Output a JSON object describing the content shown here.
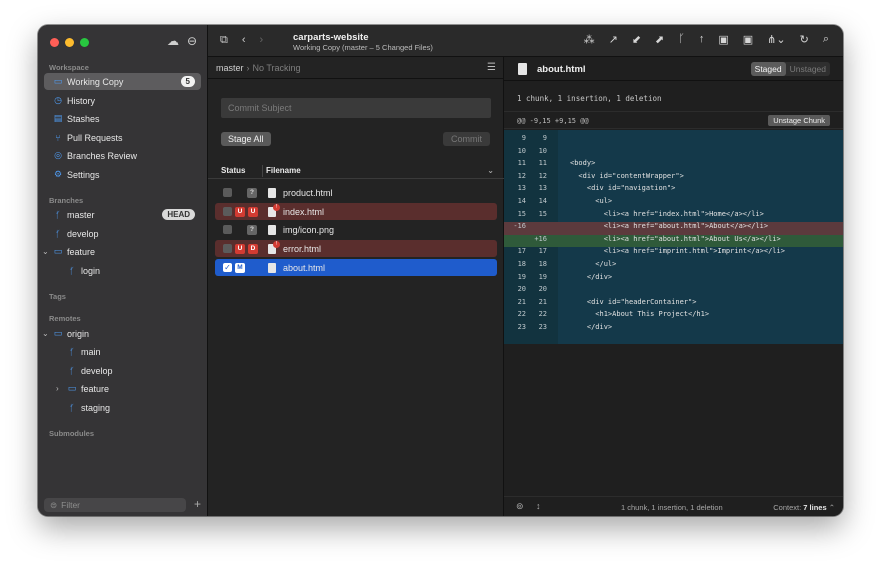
{
  "toolbar": {
    "repo_title": "carparts-website",
    "subtitle": "Working Copy (master – 5 Changed Files)"
  },
  "sidebar": {
    "workspace_label": "Workspace",
    "workspace_items": [
      {
        "label": "Working Copy",
        "badge": "5",
        "icon": "folder-icon"
      },
      {
        "label": "History",
        "icon": "clock-icon"
      },
      {
        "label": "Stashes",
        "icon": "box-icon"
      },
      {
        "label": "Pull Requests",
        "icon": "pull-request-icon"
      },
      {
        "label": "Branches Review",
        "icon": "branches-review-icon"
      },
      {
        "label": "Settings",
        "icon": "gear-icon"
      }
    ],
    "branches_label": "Branches",
    "branches": [
      {
        "label": "master",
        "tag": "HEAD"
      },
      {
        "label": "develop"
      },
      {
        "label": "feature"
      },
      {
        "label": "login"
      }
    ],
    "tags_label": "Tags",
    "remotes_label": "Remotes",
    "remotes": [
      {
        "label": "origin"
      },
      {
        "label": "main"
      },
      {
        "label": "develop"
      },
      {
        "label": "feature"
      },
      {
        "label": "staging"
      }
    ],
    "submodules_label": "Submodules",
    "filter_placeholder": "Filter"
  },
  "changes": {
    "branch": "master",
    "tracking": "No Tracking",
    "commit_placeholder": "Commit Subject",
    "stage_all": "Stage All",
    "commit": "Commit",
    "col_status": "Status",
    "col_filename": "Filename",
    "files": [
      {
        "name": "product.html",
        "status": "?"
      },
      {
        "name": "index.html",
        "status": "U"
      },
      {
        "name": "img/icon.png",
        "status": "?"
      },
      {
        "name": "error.html",
        "status": "D"
      },
      {
        "name": "about.html",
        "status": "M"
      }
    ]
  },
  "diff": {
    "file": "about.html",
    "staged": "Staged",
    "unstaged": "Unstaged",
    "summary": "1 chunk, 1 insertion, 1 deletion",
    "hunk_header": "@@ -9,15 +9,15 @@",
    "unstage_chunk": "Unstage Chunk",
    "lines": [
      {
        "old": "9",
        "new": "9",
        "text": ""
      },
      {
        "old": "10",
        "new": "10",
        "text": ""
      },
      {
        "old": "11",
        "new": "11",
        "text": "<body>"
      },
      {
        "old": "12",
        "new": "12",
        "text": "  <div id=\"contentWrapper\">"
      },
      {
        "old": "13",
        "new": "13",
        "text": "    <div id=\"navigation\">"
      },
      {
        "old": "14",
        "new": "14",
        "text": "      <ul>"
      },
      {
        "old": "15",
        "new": "15",
        "text": "        <li><a href=\"index.html\">Home</a></li>"
      },
      {
        "old": "-16",
        "new": "",
        "text": "        <li><a href=\"about.html\">About</a></li>",
        "type": "del"
      },
      {
        "old": "",
        "new": "+16",
        "text": "        <li><a href=\"about.html\">About Us</a></li>",
        "type": "add"
      },
      {
        "old": "17",
        "new": "17",
        "text": "        <li><a href=\"imprint.html\">Imprint</a></li>"
      },
      {
        "old": "18",
        "new": "18",
        "text": "      </ul>"
      },
      {
        "old": "19",
        "new": "19",
        "text": "    </div>"
      },
      {
        "old": "20",
        "new": "20",
        "text": ""
      },
      {
        "old": "21",
        "new": "21",
        "text": "    <div id=\"headerContainer\">"
      },
      {
        "old": "22",
        "new": "22",
        "text": "      <h1>About This Project</h1>"
      },
      {
        "old": "23",
        "new": "23",
        "text": "    </div>"
      }
    ],
    "footer_summary": "1 chunk, 1 insertion, 1 deletion",
    "context_label": "Context:",
    "context_value": "7 lines"
  }
}
